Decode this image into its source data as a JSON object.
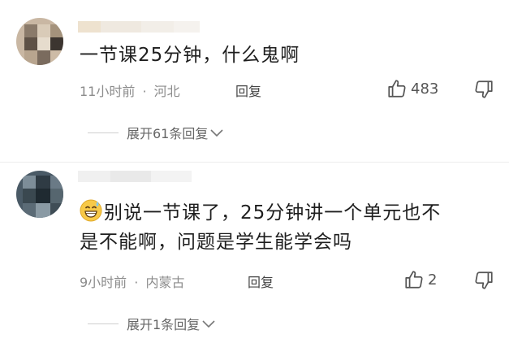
{
  "comments": [
    {
      "text": "一节课25分钟，什么鬼啊",
      "time": "11小时前",
      "location": "河北",
      "reply_label": "回复",
      "likes": "483",
      "expand_label": "展开61条回复"
    },
    {
      "emoji": "grin-sweat-icon",
      "text_line1": "别说一节课了，25分钟讲一个单元也不",
      "text_line2": "是不能啊，问题是学生能学会吗",
      "time": "9小时前",
      "location": "内蒙古",
      "reply_label": "回复",
      "likes": "2",
      "expand_label": "展开1条回复"
    }
  ],
  "separator": "·"
}
